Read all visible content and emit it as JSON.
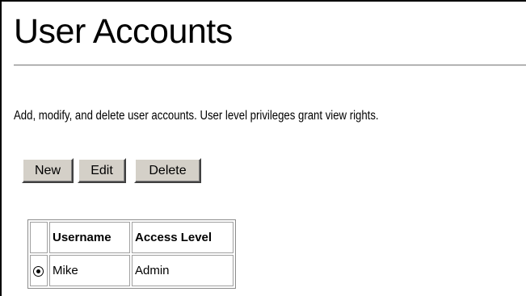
{
  "page": {
    "title": "User Accounts",
    "description": "Add, modify, and delete user accounts. User level privileges grant view rights."
  },
  "toolbar": {
    "new_label": "New",
    "edit_label": "Edit",
    "delete_label": "Delete"
  },
  "table": {
    "headers": [
      "",
      "Username",
      "Access Level"
    ],
    "rows": [
      {
        "selected": true,
        "username": "Mike",
        "access_level": "Admin"
      }
    ]
  },
  "colors": {
    "button_face": "#d4d0c8",
    "rule": "#8c8c8c",
    "text": "#000000",
    "background": "#ffffff"
  },
  "icons": {
    "row_select": "radio-button-icon"
  }
}
